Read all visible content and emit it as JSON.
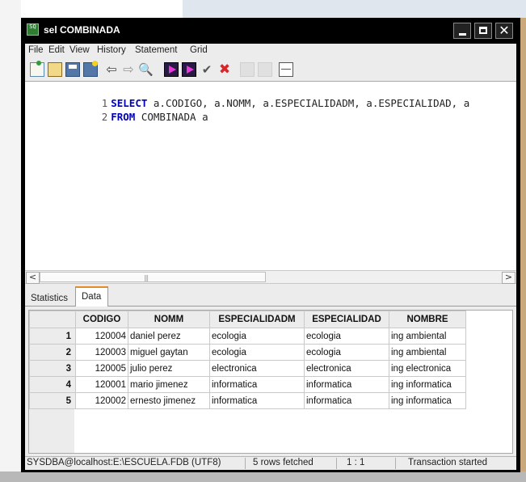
{
  "window": {
    "title": "sel COMBINADA",
    "app_icon_text": "SQ"
  },
  "menu": [
    "File",
    "Edit",
    "View",
    "History",
    "Statement",
    "Grid"
  ],
  "editor": {
    "lines": [
      {
        "number": "1",
        "keyword": "SELECT",
        "rest": " a.CODIGO, a.NOMM, a.ESPECIALIDADM, a.ESPECIALIDAD, a"
      },
      {
        "number": "2",
        "keyword": "FROM",
        "rest": " COMBINADA a"
      }
    ]
  },
  "scrollbar": {
    "left_arrow": "<",
    "right_arrow": ">",
    "grip": "|||"
  },
  "tabs": {
    "statistics": "Statistics",
    "data": "Data"
  },
  "grid": {
    "columns": [
      "CODIGO",
      "NOMM",
      "ESPECIALIDADM",
      "ESPECIALIDAD",
      "NOMBRE"
    ],
    "rows": [
      [
        "1",
        "120004",
        "daniel perez",
        "ecologia",
        "ecologia",
        "ing ambiental"
      ],
      [
        "2",
        "120003",
        "miguel gaytan",
        "ecologia",
        "ecologia",
        "ing ambiental"
      ],
      [
        "3",
        "120005",
        "julio perez",
        "electronica",
        "electronica",
        "ing electronica"
      ],
      [
        "4",
        "120001",
        "mario jimenez",
        "informatica",
        "informatica",
        "ing informatica"
      ],
      [
        "5",
        "120002",
        "ernesto jimenez",
        "informatica",
        "informatica",
        "ing informatica"
      ]
    ]
  },
  "status": {
    "connection": "SYSDBA@localhost:E:\\ESCUELA.FDB (UTF8)",
    "fetched": "5 rows fetched",
    "position": "1 : 1",
    "transaction": "Transaction started"
  },
  "icons": {
    "minimize": "minimize-icon",
    "maximize": "maximize-icon",
    "close": "close-icon",
    "close_glyph": "✕",
    "prev_glyph": "⇦",
    "next_glyph": "⇨",
    "find_glyph": "🔍",
    "commit_glyph": "✔",
    "rollback_glyph": "✖"
  },
  "colors": {
    "keyword": "#0000b8",
    "tab_accent": "#e38a2b",
    "run_button": "#e63ad6",
    "rollback": "#d8262b"
  }
}
